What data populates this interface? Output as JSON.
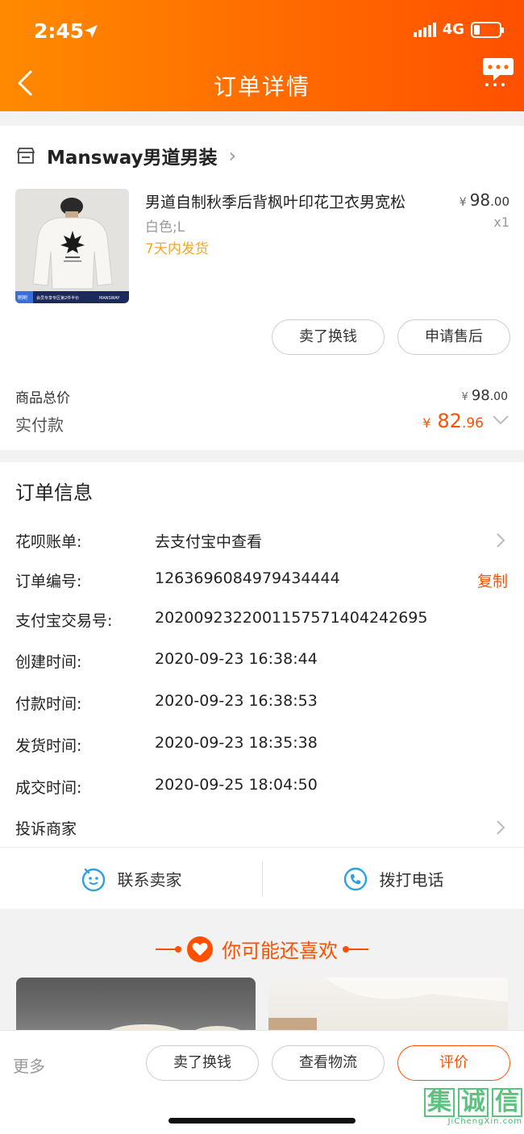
{
  "status_bar": {
    "time": "2:45",
    "network": "4G"
  },
  "header": {
    "title": "订单详情"
  },
  "shop": {
    "name": "Mansway男道男装"
  },
  "product": {
    "title": "男道自制秋季后背枫叶印花卫衣男宽松",
    "sku": "白色;L",
    "ship_note": "7天内发货",
    "price_symbol": "¥",
    "price_int": "98",
    "price_dec": ".00",
    "quantity": "x1",
    "image_banner_left": "刷刷",
    "image_banner_mid": "会员专享专区第2件半价",
    "image_banner_right": "MANSWAY"
  },
  "actions": {
    "sell_label": "卖了换钱",
    "aftersale_label": "申请售后"
  },
  "totals": {
    "goods_total_label": "商品总价",
    "goods_total_symbol": "¥",
    "goods_total_int": "98",
    "goods_total_dec": ".00",
    "paid_label": "实付款",
    "paid_symbol": "¥",
    "paid_int": "82",
    "paid_dec": ".96"
  },
  "order_info": {
    "title": "订单信息",
    "huabei_label": "花呗账单:",
    "huabei_value": "去支付宝中查看",
    "order_no_label": "订单编号:",
    "order_no_value": "1263696084979434444",
    "copy_label": "复制",
    "alipay_no_label": "支付宝交易号:",
    "alipay_no_value": "2020092322001157571404242695",
    "created_label": "创建时间:",
    "created_value": "2020-09-23 16:38:44",
    "paid_label": "付款时间:",
    "paid_value": "2020-09-23 16:38:53",
    "shipped_label": "发货时间:",
    "shipped_value": "2020-09-23 18:35:38",
    "completed_label": "成交时间:",
    "completed_value": "2020-09-25 18:04:50",
    "complaint_label": "投诉商家"
  },
  "contact": {
    "seller_label": "联系卖家",
    "call_label": "拨打电话"
  },
  "recommend": {
    "title": "你可能还喜欢"
  },
  "bottom_bar": {
    "more_label": "更多",
    "sell_label": "卖了换钱",
    "logistics_label": "查看物流",
    "review_label": "评价"
  },
  "watermark": {
    "chars": [
      "集",
      "诚",
      "信"
    ],
    "url": "JiChengXin.com"
  },
  "colors": {
    "brand": "#ff5000",
    "ship_note": "#f5a623",
    "watermark": "#3fb86a"
  }
}
